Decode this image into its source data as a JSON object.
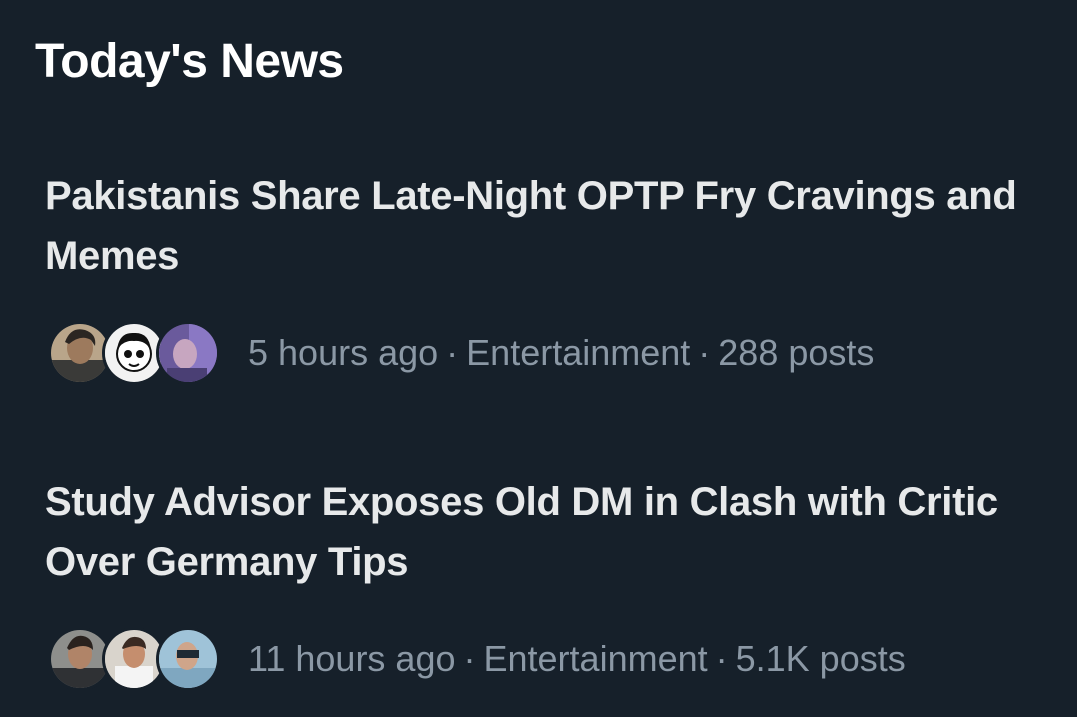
{
  "section": {
    "title": "Today's News"
  },
  "news": [
    {
      "headline": "Pakistanis Share Late-Night OPTP Fry Cravings and Memes",
      "time": "5 hours ago",
      "category": "Entertainment",
      "posts": "288 posts",
      "separator": "·",
      "avatars": [
        "user-avatar",
        "cartoon-avatar",
        "user-avatar"
      ]
    },
    {
      "headline": "Study Advisor Exposes Old DM in Clash with Critic Over Germany Tips",
      "time": "11 hours ago",
      "category": "Entertainment",
      "posts": "5.1K posts",
      "separator": "·",
      "avatars": [
        "user-avatar",
        "user-avatar",
        "user-avatar"
      ]
    }
  ],
  "colors": {
    "background": "#16202a",
    "primary_text": "#e7e9ea",
    "secondary_text": "#8b98a5"
  }
}
